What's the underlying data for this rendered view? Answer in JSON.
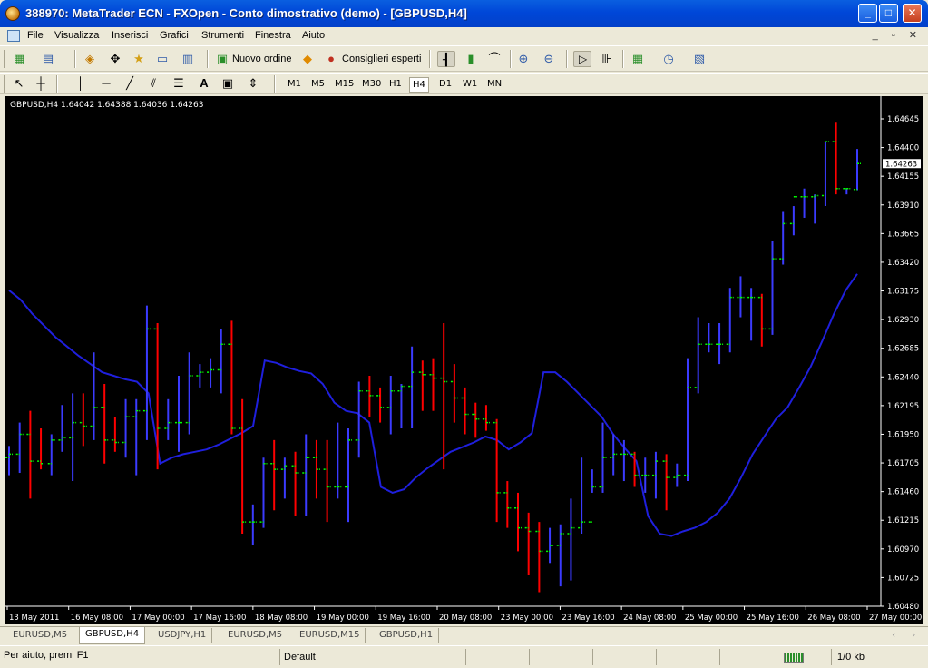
{
  "window": {
    "title": "388970: MetaTrader ECN - FXOpen - Conto dimostrativo (demo) - [GBPUSD,H4]",
    "min": "_",
    "max": "□",
    "close": "✕"
  },
  "menu": [
    "File",
    "Visualizza",
    "Inserisci",
    "Grafici",
    "Strumenti",
    "Finestra",
    "Aiuto"
  ],
  "doc_controls": "_ ▫ ✕",
  "toolbar": {
    "new_order": "Nuovo ordine",
    "expert_advisors": "Consiglieri esperti"
  },
  "drawing_tools": {
    "text": "A"
  },
  "timeframes": [
    "M1",
    "M5",
    "M15",
    "M30",
    "H1",
    "H4",
    "D1",
    "W1",
    "MN"
  ],
  "active_timeframe": "H4",
  "chart_data": {
    "type": "ohlc-bar",
    "header": "GBPUSD,H4  1.64042 1.64388 1.64036 1.64263",
    "current_price": "1.64263",
    "price_labels": [
      "1.64645",
      "1.64400",
      "1.64155",
      "1.63910",
      "1.63665",
      "1.63420",
      "1.63175",
      "1.62930",
      "1.62685",
      "1.62440",
      "1.62195",
      "1.61950",
      "1.61705",
      "1.61460",
      "1.61215",
      "1.60970",
      "1.60725",
      "1.60480"
    ],
    "price_values": [
      1.64645,
      1.644,
      1.64155,
      1.6391,
      1.63665,
      1.6342,
      1.63175,
      1.6293,
      1.62685,
      1.6244,
      1.62195,
      1.6195,
      1.61705,
      1.6146,
      1.61215,
      1.6097,
      1.60725,
      1.6048
    ],
    "time_labels": [
      "13 May 2011",
      "16 May 08:00",
      "17 May 00:00",
      "17 May 16:00",
      "18 May 08:00",
      "19 May 00:00",
      "19 May 16:00",
      "20 May 08:00",
      "23 May 00:00",
      "23 May 16:00",
      "24 May 08:00",
      "25 May 00:00",
      "25 May 16:00",
      "26 May 08:00",
      "27 May 00:00"
    ],
    "ylim": [
      1.6048,
      1.64645
    ],
    "up_color": "#3b3bff",
    "down_color": "#ff0000",
    "close_tick_color": "#00ff00",
    "ma_color": "#1f1fdd",
    "background": "#000000",
    "bars": [
      {
        "o": 1.6175,
        "h": 1.6185,
        "l": 1.616,
        "c": 1.6178
      },
      {
        "o": 1.6178,
        "h": 1.6205,
        "l": 1.6162,
        "c": 1.6195
      },
      {
        "o": 1.6195,
        "h": 1.6215,
        "l": 1.614,
        "c": 1.6172
      },
      {
        "o": 1.6172,
        "h": 1.62,
        "l": 1.6165,
        "c": 1.617
      },
      {
        "o": 1.617,
        "h": 1.6195,
        "l": 1.616,
        "c": 1.619
      },
      {
        "o": 1.619,
        "h": 1.622,
        "l": 1.618,
        "c": 1.6192
      },
      {
        "o": 1.6192,
        "h": 1.623,
        "l": 1.6155,
        "c": 1.6205
      },
      {
        "o": 1.6205,
        "h": 1.623,
        "l": 1.6185,
        "c": 1.6202
      },
      {
        "o": 1.6202,
        "h": 1.6265,
        "l": 1.619,
        "c": 1.6218
      },
      {
        "o": 1.6218,
        "h": 1.6238,
        "l": 1.617,
        "c": 1.619
      },
      {
        "o": 1.619,
        "h": 1.621,
        "l": 1.618,
        "c": 1.6188
      },
      {
        "o": 1.6188,
        "h": 1.6225,
        "l": 1.6175,
        "c": 1.621
      },
      {
        "o": 1.621,
        "h": 1.6225,
        "l": 1.616,
        "c": 1.6215
      },
      {
        "o": 1.6215,
        "h": 1.6305,
        "l": 1.619,
        "c": 1.6285
      },
      {
        "o": 1.6285,
        "h": 1.629,
        "l": 1.6165,
        "c": 1.62
      },
      {
        "o": 1.62,
        "h": 1.6225,
        "l": 1.619,
        "c": 1.6205
      },
      {
        "o": 1.6205,
        "h": 1.6245,
        "l": 1.618,
        "c": 1.6205
      },
      {
        "o": 1.6205,
        "h": 1.6265,
        "l": 1.6195,
        "c": 1.6245
      },
      {
        "o": 1.6245,
        "h": 1.6255,
        "l": 1.6235,
        "c": 1.6248
      },
      {
        "o": 1.6248,
        "h": 1.626,
        "l": 1.6235,
        "c": 1.625
      },
      {
        "o": 1.625,
        "h": 1.6285,
        "l": 1.623,
        "c": 1.6272
      },
      {
        "o": 1.6272,
        "h": 1.6292,
        "l": 1.6195,
        "c": 1.62
      },
      {
        "o": 1.62,
        "h": 1.6225,
        "l": 1.611,
        "c": 1.612
      },
      {
        "o": 1.612,
        "h": 1.6135,
        "l": 1.61,
        "c": 1.612
      },
      {
        "o": 1.612,
        "h": 1.6175,
        "l": 1.6115,
        "c": 1.617
      },
      {
        "o": 1.617,
        "h": 1.619,
        "l": 1.613,
        "c": 1.6165
      },
      {
        "o": 1.6165,
        "h": 1.6175,
        "l": 1.614,
        "c": 1.6168
      },
      {
        "o": 1.6168,
        "h": 1.618,
        "l": 1.6125,
        "c": 1.6162
      },
      {
        "o": 1.6162,
        "h": 1.6195,
        "l": 1.6125,
        "c": 1.6175
      },
      {
        "o": 1.6175,
        "h": 1.619,
        "l": 1.614,
        "c": 1.6165
      },
      {
        "o": 1.6165,
        "h": 1.619,
        "l": 1.612,
        "c": 1.615
      },
      {
        "o": 1.615,
        "h": 1.6205,
        "l": 1.614,
        "c": 1.615
      },
      {
        "o": 1.615,
        "h": 1.62,
        "l": 1.612,
        "c": 1.619
      },
      {
        "o": 1.619,
        "h": 1.624,
        "l": 1.6175,
        "c": 1.6232
      },
      {
        "o": 1.6232,
        "h": 1.6245,
        "l": 1.621,
        "c": 1.6228
      },
      {
        "o": 1.6228,
        "h": 1.6235,
        "l": 1.6205,
        "c": 1.6218
      },
      {
        "o": 1.6218,
        "h": 1.6245,
        "l": 1.6195,
        "c": 1.6232
      },
      {
        "o": 1.6232,
        "h": 1.6238,
        "l": 1.62,
        "c": 1.6236
      },
      {
        "o": 1.6236,
        "h": 1.627,
        "l": 1.62,
        "c": 1.6248
      },
      {
        "o": 1.6248,
        "h": 1.6258,
        "l": 1.6215,
        "c": 1.6246
      },
      {
        "o": 1.6246,
        "h": 1.626,
        "l": 1.6215,
        "c": 1.6243
      },
      {
        "o": 1.6243,
        "h": 1.629,
        "l": 1.6165,
        "c": 1.624
      },
      {
        "o": 1.624,
        "h": 1.6255,
        "l": 1.6205,
        "c": 1.6226
      },
      {
        "o": 1.6226,
        "h": 1.6235,
        "l": 1.6195,
        "c": 1.6212
      },
      {
        "o": 1.6212,
        "h": 1.6222,
        "l": 1.6192,
        "c": 1.6208
      },
      {
        "o": 1.6208,
        "h": 1.622,
        "l": 1.6198,
        "c": 1.6205
      },
      {
        "o": 1.6205,
        "h": 1.6208,
        "l": 1.612,
        "c": 1.6145
      },
      {
        "o": 1.6145,
        "h": 1.6155,
        "l": 1.6115,
        "c": 1.6132
      },
      {
        "o": 1.6132,
        "h": 1.6145,
        "l": 1.6095,
        "c": 1.6115
      },
      {
        "o": 1.6115,
        "h": 1.6128,
        "l": 1.6075,
        "c": 1.6112
      },
      {
        "o": 1.6112,
        "h": 1.612,
        "l": 1.606,
        "c": 1.6095
      },
      {
        "o": 1.6095,
        "h": 1.6115,
        "l": 1.6085,
        "c": 1.61
      },
      {
        "o": 1.61,
        "h": 1.6118,
        "l": 1.6065,
        "c": 1.611
      },
      {
        "o": 1.611,
        "h": 1.614,
        "l": 1.607,
        "c": 1.6115
      },
      {
        "o": 1.6115,
        "h": 1.6175,
        "l": 1.611,
        "c": 1.612
      },
      {
        "o": 1.612,
        "h": 1.6165,
        "l": 1.6145,
        "c": 1.615
      },
      {
        "o": 1.615,
        "h": 1.6205,
        "l": 1.6145,
        "c": 1.6175
      },
      {
        "o": 1.6175,
        "h": 1.6195,
        "l": 1.616,
        "c": 1.6178
      },
      {
        "o": 1.6178,
        "h": 1.619,
        "l": 1.6155,
        "c": 1.6178
      },
      {
        "o": 1.6178,
        "h": 1.618,
        "l": 1.615,
        "c": 1.616
      },
      {
        "o": 1.616,
        "h": 1.6175,
        "l": 1.6145,
        "c": 1.616
      },
      {
        "o": 1.616,
        "h": 1.618,
        "l": 1.614,
        "c": 1.6172
      },
      {
        "o": 1.6172,
        "h": 1.6178,
        "l": 1.613,
        "c": 1.6158
      },
      {
        "o": 1.6158,
        "h": 1.617,
        "l": 1.615,
        "c": 1.616
      },
      {
        "o": 1.616,
        "h": 1.626,
        "l": 1.6155,
        "c": 1.6235
      },
      {
        "o": 1.6235,
        "h": 1.6295,
        "l": 1.623,
        "c": 1.6272
      },
      {
        "o": 1.6272,
        "h": 1.629,
        "l": 1.6265,
        "c": 1.6272
      },
      {
        "o": 1.6272,
        "h": 1.629,
        "l": 1.6255,
        "c": 1.6272
      },
      {
        "o": 1.6272,
        "h": 1.632,
        "l": 1.6265,
        "c": 1.6312
      },
      {
        "o": 1.6312,
        "h": 1.633,
        "l": 1.6295,
        "c": 1.6312
      },
      {
        "o": 1.6312,
        "h": 1.632,
        "l": 1.6275,
        "c": 1.6312
      },
      {
        "o": 1.6312,
        "h": 1.6315,
        "l": 1.627,
        "c": 1.6285
      },
      {
        "o": 1.6285,
        "h": 1.636,
        "l": 1.628,
        "c": 1.6345
      },
      {
        "o": 1.6345,
        "h": 1.6385,
        "l": 1.634,
        "c": 1.6375
      },
      {
        "o": 1.6375,
        "h": 1.639,
        "l": 1.6365,
        "c": 1.6398
      },
      {
        "o": 1.6398,
        "h": 1.6405,
        "l": 1.638,
        "c": 1.6398
      },
      {
        "o": 1.6398,
        "h": 1.64,
        "l": 1.6375,
        "c": 1.6399
      },
      {
        "o": 1.6399,
        "h": 1.6445,
        "l": 1.639,
        "c": 1.6445
      },
      {
        "o": 1.6445,
        "h": 1.6462,
        "l": 1.64,
        "c": 1.6405
      },
      {
        "o": 1.6405,
        "h": 1.6405,
        "l": 1.64,
        "c": 1.6405
      },
      {
        "o": 1.64042,
        "h": 1.64388,
        "l": 1.64036,
        "c": 1.64263
      }
    ],
    "ma": [
      1.6318,
      1.631,
      1.6298,
      1.6288,
      1.6278,
      1.627,
      1.6262,
      1.6255,
      1.6248,
      1.6245,
      1.6242,
      1.624,
      1.623,
      1.617,
      1.6175,
      1.6178,
      1.618,
      1.6182,
      1.6186,
      1.6191,
      1.6196,
      1.6202,
      1.6258,
      1.6256,
      1.6252,
      1.6249,
      1.6247,
      1.6238,
      1.6222,
      1.6215,
      1.6213,
      1.6205,
      1.615,
      1.6145,
      1.6148,
      1.6158,
      1.6166,
      1.6173,
      1.618,
      1.6184,
      1.6188,
      1.6193,
      1.619,
      1.6182,
      1.6188,
      1.6196,
      1.6248,
      1.6248,
      1.624,
      1.623,
      1.622,
      1.621,
      1.6195,
      1.6183,
      1.6172,
      1.6125,
      1.611,
      1.6108,
      1.6112,
      1.6115,
      1.612,
      1.6128,
      1.614,
      1.6158,
      1.6178,
      1.6193,
      1.6208,
      1.6218,
      1.6235,
      1.6253,
      1.6275,
      1.6298,
      1.6318,
      1.6332
    ]
  },
  "tabs": [
    "EURUSD,M5",
    "GBPUSD,H4",
    "USDJPY,H1",
    "EURUSD,M5",
    "EURUSD,M15",
    "GBPUSD,H1"
  ],
  "active_tab": 1,
  "status": {
    "help": "Per aiuto, premi F1",
    "profile": "Default",
    "traffic": "1/0 kb"
  }
}
